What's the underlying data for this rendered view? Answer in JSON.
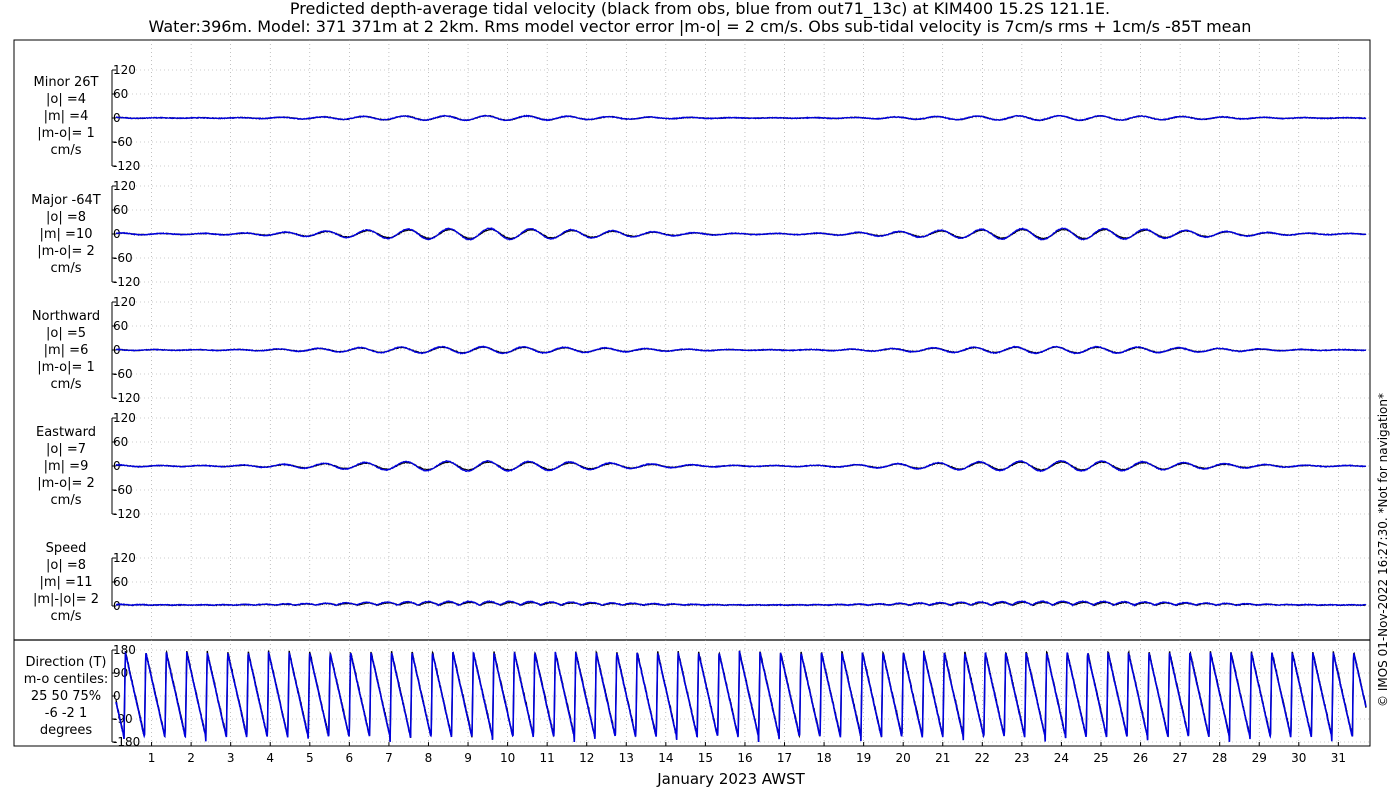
{
  "title_line1": "Predicted depth-average tidal velocity (black from obs, blue from out71_13c) at KIM400 15.2S 121.1E.",
  "title_line2": "Water:396m. Model: 371 371m at 2 2km. Rms model vector error |m-o| = 2 cm/s. Obs sub-tidal velocity is 7cm/s rms + 1cm/s -85T mean",
  "copyright": "© IMOS 01-Nov-2022 16:27:30. *Not for navigation*",
  "colors": {
    "obs": "#000000",
    "model": "#0000dd",
    "grid": "#999999"
  },
  "chart_data": {
    "type": "line",
    "x_label": "January 2023 AWST",
    "x_ticks": [
      "1",
      "2",
      "3",
      "4",
      "5",
      "6",
      "7",
      "8",
      "9",
      "10",
      "11",
      "12",
      "13",
      "14",
      "15",
      "16",
      "17",
      "18",
      "19",
      "20",
      "21",
      "22",
      "23",
      "24",
      "25",
      "26",
      "27",
      "28",
      "29",
      "30",
      "31"
    ],
    "x_range_days": [
      0,
      31.8
    ],
    "series_names": [
      "obs",
      "model"
    ],
    "panels": [
      {
        "name": "minor",
        "label_lines": [
          "Minor 26T",
          "|o| =4",
          "|m| =4",
          "|m-o|= 1",
          "cm/s"
        ],
        "yticks": [
          "120",
          "60",
          "0",
          "-60",
          "-120"
        ],
        "ylim": [
          -120,
          120
        ],
        "obs_rms": 4,
        "model_rms": 4
      },
      {
        "name": "major",
        "label_lines": [
          "Major -64T",
          "|o| =8",
          "|m| =10",
          "|m-o|= 2",
          "cm/s"
        ],
        "yticks": [
          "120",
          "60",
          "0",
          "-60",
          "-120"
        ],
        "ylim": [
          -120,
          120
        ],
        "obs_rms": 8,
        "model_rms": 10
      },
      {
        "name": "northward",
        "label_lines": [
          "Northward",
          "|o| =5",
          "|m| =6",
          "|m-o|= 1",
          "cm/s"
        ],
        "yticks": [
          "120",
          "60",
          "0",
          "-60",
          "-120"
        ],
        "ylim": [
          -120,
          120
        ],
        "obs_rms": 5,
        "model_rms": 6
      },
      {
        "name": "eastward",
        "label_lines": [
          "Eastward",
          "|o| =7",
          "|m| =9",
          "|m-o|= 2",
          "cm/s"
        ],
        "yticks": [
          "120",
          "60",
          "0",
          "-60",
          "-120"
        ],
        "ylim": [
          -120,
          120
        ],
        "obs_rms": 7,
        "model_rms": 9
      },
      {
        "name": "speed",
        "label_lines": [
          "Speed",
          "|o| =8",
          "|m| =11",
          "|m|-|o|= 2",
          "cm/s"
        ],
        "yticks": [
          "120",
          "60",
          "0"
        ],
        "ylim": [
          0,
          120
        ],
        "obs_rms": 8,
        "model_rms": 11
      },
      {
        "name": "direction",
        "label_lines": [
          "Direction (T)",
          "m-o centiles:",
          "25  50  75%",
          "-6  -2  1",
          "degrees"
        ],
        "yticks": [
          "180",
          "90",
          "0",
          "-90",
          "-180"
        ],
        "ylim": [
          -180,
          180
        ]
      }
    ]
  }
}
